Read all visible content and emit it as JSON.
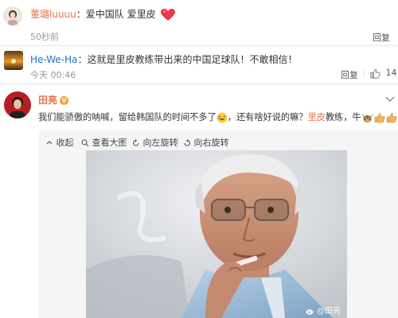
{
  "comment1": {
    "user": "董璐luuuu",
    "text": "：爱中国队 爱里皮",
    "time": "50秒前",
    "reply_label": "回复"
  },
  "comment2": {
    "user": "He-We-Ha",
    "text": "：这就是里皮教练带出来的中国足球队！不敢相信！",
    "time": "今天 00:46",
    "reply_label": "回复",
    "like_count": "14"
  },
  "post": {
    "user": "田亮",
    "text_part1": "我们能骄傲的呐喊，留给韩国队的时间不多了",
    "text_part2": "，还有啥好说的嘛？",
    "highlight": "里皮",
    "text_part3": "教练，牛",
    "toolbar": {
      "collapse": "收起",
      "view_large": "查看大图",
      "rotate_left": "向左旋转",
      "rotate_right": "向右旋转"
    },
    "watermark": "@田亮"
  },
  "colors": {
    "orange_name": "#eb7350",
    "blue_name": "#1a73c4",
    "heart": "#e8394d"
  }
}
